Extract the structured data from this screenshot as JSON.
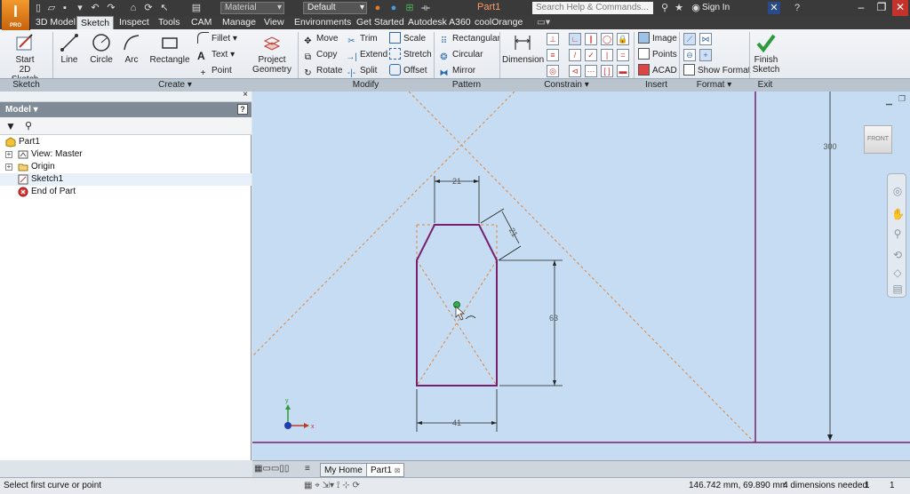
{
  "app": {
    "logo_letter": "I",
    "logo_sub": "PRO",
    "document_title": "Part1"
  },
  "quick_access": {
    "material": "Material",
    "appearance": "Default",
    "search_placeholder": "Search Help & Commands...",
    "sign_in": "Sign In"
  },
  "ribbon_tabs": [
    "3D Model",
    "Sketch",
    "Inspect",
    "Tools",
    "CAM",
    "Manage",
    "View",
    "Environments",
    "Get Started",
    "Autodesk A360",
    "coolOrange"
  ],
  "active_tab": "Sketch",
  "ribbon": {
    "sketch": {
      "start_label_1": "Start",
      "start_label_2": "2D Sketch"
    },
    "create": {
      "line": "Line",
      "circle": "Circle",
      "arc": "Arc",
      "rectangle": "Rectangle",
      "fillet": "Fillet",
      "text": "Text",
      "point": "Point",
      "project_1": "Project",
      "project_2": "Geometry"
    },
    "modify": {
      "move": "Move",
      "copy": "Copy",
      "rotate": "Rotate",
      "trim": "Trim",
      "extend": "Extend",
      "split": "Split",
      "scale": "Scale",
      "stretch": "Stretch",
      "offset": "Offset"
    },
    "pattern": {
      "rectangular": "Rectangular",
      "circular": "Circular",
      "mirror": "Mirror"
    },
    "constrain": {
      "dimension": "Dimension"
    },
    "insert": {
      "image": "Image",
      "points": "Points",
      "acad": "ACAD"
    },
    "format": {
      "show_format": "Show Format"
    },
    "exit": {
      "finish_1": "Finish",
      "finish_2": "Sketch"
    },
    "panels": {
      "sketch": "Sketch",
      "create": "Create",
      "modify": "Modify",
      "pattern": "Pattern",
      "constrain": "Constrain",
      "insert": "Insert",
      "format": "Format",
      "exit": "Exit"
    }
  },
  "browser": {
    "title": "Model",
    "items": [
      "Part1",
      "View: Master",
      "Origin",
      "Sketch1",
      "End of Part"
    ]
  },
  "canvas": {
    "viewcube_label": "FRONT",
    "dimensions": {
      "top_width": "21",
      "chamfer": "21",
      "height": "63",
      "bottom_width": "41",
      "overall": "300"
    },
    "colors": {
      "background": "#c5dcf2",
      "profile": "#7a1f6e",
      "construction": "#e0843a",
      "dimension": "#222222"
    }
  },
  "doc_tabs": [
    "My Home",
    "Part1"
  ],
  "status": {
    "prompt": "Select first curve or point",
    "coords": "146.742 mm, 69.890 mm",
    "dims_needed": "4 dimensions needed",
    "count1": "1",
    "count2": "1"
  }
}
